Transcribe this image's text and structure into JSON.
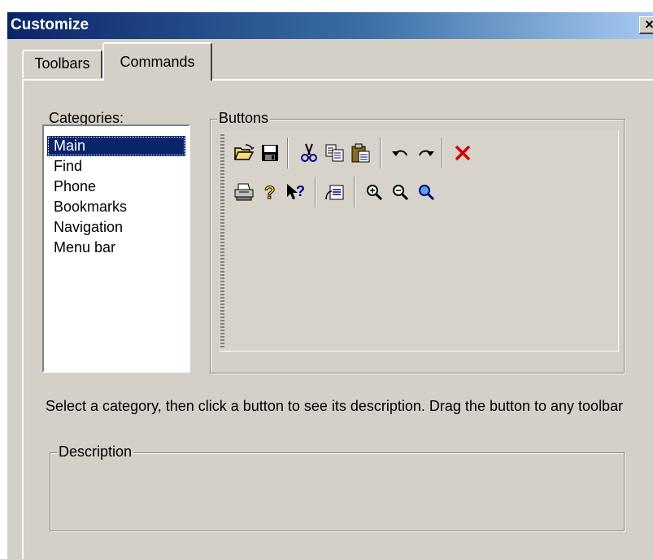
{
  "window": {
    "title": "Customize",
    "close_glyph": "×"
  },
  "tabs": [
    {
      "label": "Toolbars"
    },
    {
      "label": "Commands"
    }
  ],
  "categories": {
    "label": "Categories:",
    "items": [
      "Main",
      "Find",
      "Phone",
      "Bookmarks",
      "Navigation",
      "Menu bar"
    ],
    "selected": "Main"
  },
  "buttons_group": {
    "label": "Buttons",
    "row1": [
      "open-folder-icon",
      "save-icon",
      "cut-icon",
      "copy-icon",
      "paste-icon",
      "undo-icon",
      "redo-icon",
      "delete-icon"
    ],
    "row2": [
      "print-icon",
      "help-icon",
      "context-help-icon",
      "properties-icon",
      "zoom-in-icon",
      "zoom-out-icon",
      "zoom-icon"
    ]
  },
  "instructions": "Select a category, then click a button to see its description. Drag the button to any toolbar",
  "description_group": {
    "label": "Description"
  },
  "colors": {
    "selection": "#0a246a",
    "face": "#d4d0c8",
    "delete_red": "#d40000"
  }
}
